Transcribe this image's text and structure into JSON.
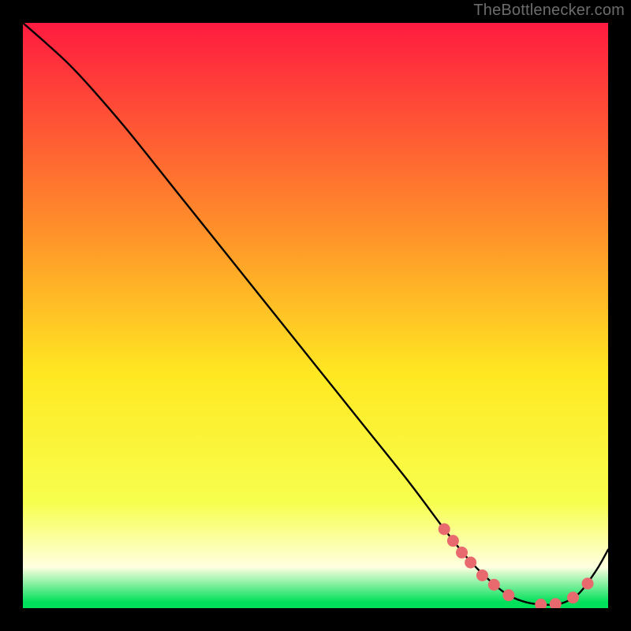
{
  "attribution": "TheBottlenecker.com",
  "colors": {
    "page_bg": "#000000",
    "grad_top": "#ff1b40",
    "grad_mid_upper": "#ff8f2a",
    "grad_mid": "#ffe822",
    "grad_lower": "#f7ff4e",
    "grad_pale": "#ffffe0",
    "grad_green": "#00e05a",
    "curve": "#000000",
    "marker_fill": "#e86a6e",
    "marker_stroke": "#e86a6e"
  },
  "chart_data": {
    "type": "line",
    "title": "",
    "xlabel": "",
    "ylabel": "",
    "xlim": [
      0,
      100
    ],
    "ylim": [
      0,
      100
    ],
    "series": [
      {
        "name": "bottleneck-curve",
        "x": [
          0,
          4,
          8,
          12,
          18,
          26,
          34,
          42,
          50,
          58,
          66,
          72,
          76,
          80,
          83,
          86,
          89,
          92,
          95,
          98,
          100
        ],
        "y": [
          100,
          96.5,
          92.8,
          88.5,
          81.5,
          71.5,
          61.5,
          51.5,
          41.5,
          31.5,
          21.5,
          13.5,
          8.5,
          4.5,
          2.2,
          1.0,
          0.6,
          0.8,
          2.5,
          6.5,
          10.0
        ]
      }
    ],
    "markers": [
      {
        "x": 72.0,
        "y": 13.5
      },
      {
        "x": 73.5,
        "y": 11.5
      },
      {
        "x": 75.0,
        "y": 9.5
      },
      {
        "x": 76.5,
        "y": 7.8
      },
      {
        "x": 78.5,
        "y": 5.6
      },
      {
        "x": 80.5,
        "y": 4.0
      },
      {
        "x": 83.0,
        "y": 2.2
      },
      {
        "x": 88.5,
        "y": 0.6
      },
      {
        "x": 91.0,
        "y": 0.7
      },
      {
        "x": 94.0,
        "y": 1.8
      },
      {
        "x": 96.5,
        "y": 4.2
      }
    ]
  }
}
